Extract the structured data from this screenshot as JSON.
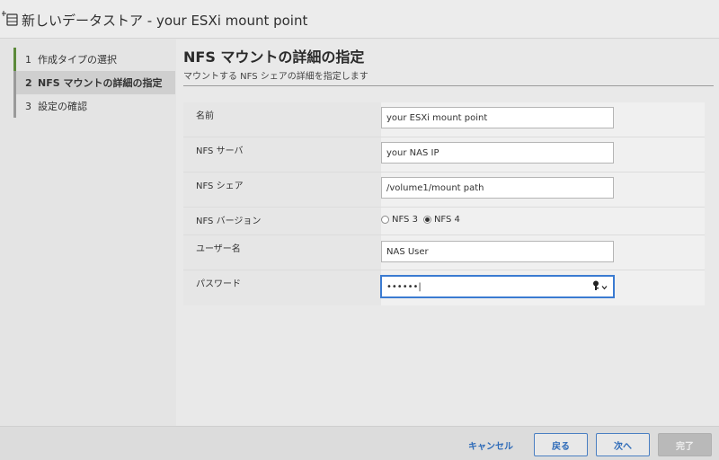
{
  "window": {
    "title": "新しいデータストア - your ESXi mount point",
    "icon": "new-datastore-icon"
  },
  "steps": [
    {
      "num": "1",
      "label": "作成タイプの選択",
      "state": "done"
    },
    {
      "num": "2",
      "label": "NFS マウントの詳細の指定",
      "state": "active"
    },
    {
      "num": "3",
      "label": "設定の確認",
      "state": "pending"
    }
  ],
  "main": {
    "title": "NFS マウントの詳細の指定",
    "subtitle": "マウントする NFS シェアの詳細を指定します"
  },
  "form": {
    "name": {
      "label": "名前",
      "value": "your ESXi mount point"
    },
    "server": {
      "label": "NFS サーバ",
      "value": "your NAS IP"
    },
    "share": {
      "label": "NFS シェア",
      "value": "/volume1/mount path"
    },
    "version": {
      "label": "NFS バージョン",
      "options": [
        {
          "label": "NFS 3",
          "selected": false
        },
        {
          "label": "NFS 4",
          "selected": true
        }
      ]
    },
    "user": {
      "label": "ユーザー名",
      "value": "NAS User"
    },
    "password": {
      "label": "パスワード",
      "value": "••••••|",
      "icon": "key-icon"
    }
  },
  "footer": {
    "cancel": "キャンセル",
    "back": "戻る",
    "next": "次へ",
    "finish": "完了"
  },
  "colors": {
    "accent": "#2e6bb8",
    "focus": "#3b7bd1",
    "done_step": "#5c8a3a"
  }
}
